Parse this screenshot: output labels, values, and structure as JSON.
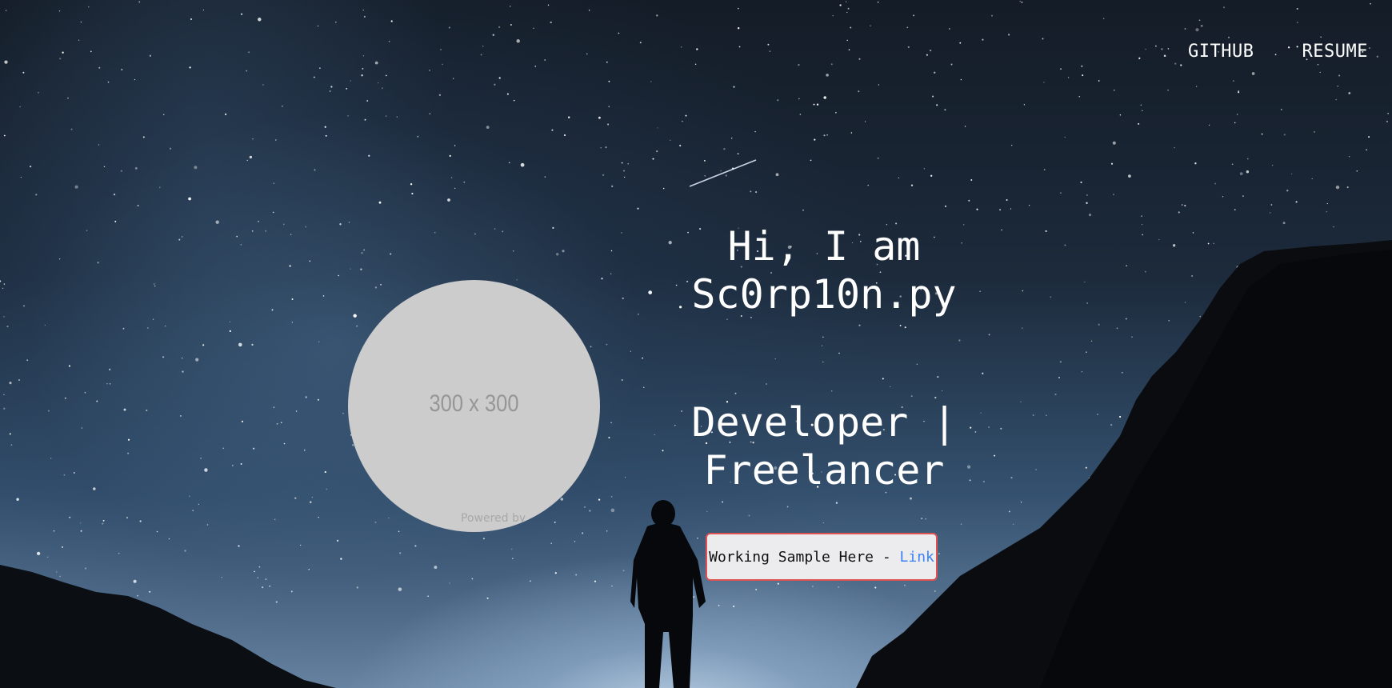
{
  "nav": {
    "items": [
      {
        "label": "GITHUB"
      },
      {
        "label": "RESUME"
      }
    ]
  },
  "avatar": {
    "placeholder_text": "300 x 300",
    "powered_text": "Powered by"
  },
  "hero": {
    "greeting_line1": "Hi, I am",
    "greeting_line2": "Sc0rp10n.py",
    "role_line1": "Developer |",
    "role_line2": "Freelancer"
  },
  "sample": {
    "text": "Working Sample Here - ",
    "link_label": "Link"
  },
  "colors": {
    "text": "#ffffff",
    "link": "#3b82f6",
    "box_border": "#e05252",
    "box_bg": "#ececef",
    "avatar_bg": "#cccccc"
  }
}
